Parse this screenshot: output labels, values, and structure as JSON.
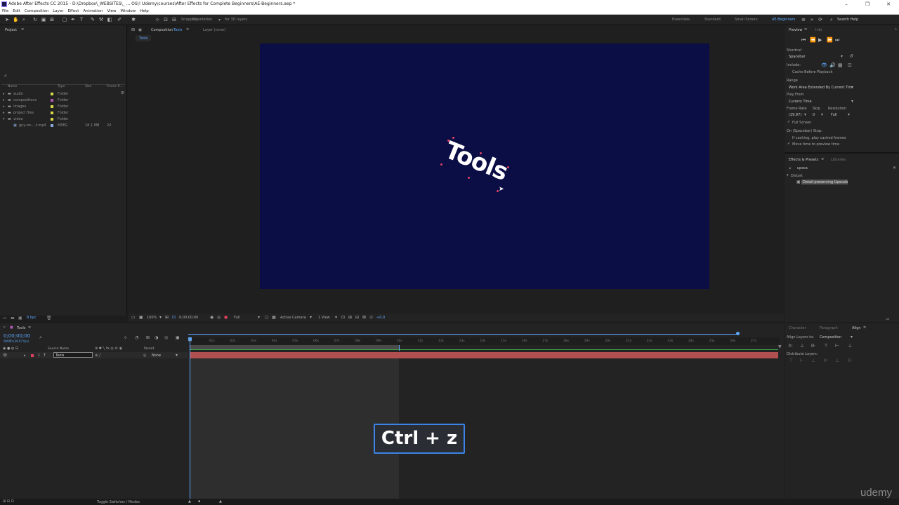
{
  "window": {
    "title": "Adobe After Effects CC 2015 - D:\\Dropbox\\_WEBSITES\\_ ... OS\\! Udemy\\courses\\After Effects for Complete Beginners\\AE-Beginners.aep *",
    "minimize": "–",
    "maximize": "❐",
    "close": "✕"
  },
  "menu": [
    "File",
    "Edit",
    "Composition",
    "Layer",
    "Effect",
    "Animation",
    "View",
    "Window",
    "Help"
  ],
  "toolbar": {
    "snapping": "Snapping",
    "orientation": "Orientation",
    "for3d": "for 3D layers",
    "workspaces": [
      "Essentials",
      "Standard",
      "Small Screen",
      "AE-Beginners"
    ],
    "search_help": "Search Help"
  },
  "project": {
    "tab": "Project",
    "columns": [
      "Name",
      "Type",
      "Size",
      "Frame R..."
    ],
    "items": [
      {
        "name": "audio",
        "type": "Folder",
        "size": "",
        "fr": "",
        "color": "#d8d84a"
      },
      {
        "name": "compositions",
        "type": "Folder",
        "size": "",
        "fr": "",
        "color": "#b05ab0"
      },
      {
        "name": "images",
        "type": "Folder",
        "size": "",
        "fr": "",
        "color": "#d8d84a"
      },
      {
        "name": "project files",
        "type": "Folder",
        "size": "",
        "fr": "",
        "color": "#d8d84a"
      },
      {
        "name": "video",
        "type": "Folder",
        "size": "",
        "fr": "",
        "color": "#d8d84a"
      },
      {
        "name": "guy-on-...t.mp4",
        "type": "MPEG",
        "size": "18.1 MB",
        "fr": "24",
        "color": "#8aa6d6"
      }
    ],
    "bpc": "8 bpc"
  },
  "composition": {
    "tab": "Composition",
    "tab_name": "Tools",
    "layer_tab": "Layer (none)",
    "subtab": "Tools",
    "canvas_text": "Tools",
    "canvas_color": "#0b0d45",
    "zoom": "100%",
    "timecode": "0;00;00;00",
    "resolution": "Full",
    "camera": "Active Camera",
    "views": "1 View",
    "exposure": "+0.0"
  },
  "preview": {
    "tab": "Preview",
    "tab2": "Info",
    "shortcut_label": "Shortcut",
    "shortcut_value": "Spacebar",
    "include_label": "Include:",
    "cache_label": "Cache Before Playback",
    "range_label": "Range",
    "range_value": "Work Area Extended By Current Tim",
    "playfrom_label": "Play From",
    "playfrom_value": "Current Time",
    "framerate_label": "Frame Rate",
    "skip_label": "Skip",
    "resolution_label": "Resolution",
    "framerate_value": "(29.97)",
    "skip_value": "0",
    "resolution_value": "Full",
    "fullscreen": "Full Screen",
    "onstop_label": "On (Spacebar) Stop:",
    "ifcaching": "If caching, play cached frames",
    "movetime": "Move time to preview time"
  },
  "effects": {
    "tab": "Effects & Presets",
    "tab2": "Libraries",
    "search": "upsca",
    "category": "Distort",
    "result": "Detail-preserving Upscale"
  },
  "timeline": {
    "tab": "Tools",
    "timecode": "0;00;00;00",
    "fps": "00000 (29.97 fps)",
    "columns": [
      "Source Name",
      "Parent"
    ],
    "layer_num": "1",
    "layer_name": "Tools",
    "parent": "None",
    "ticks": [
      "0s",
      "01s",
      "02s",
      "03s",
      "04s",
      "05s",
      "06s",
      "07s",
      "08s",
      "09s",
      "10s",
      "11s",
      "12s",
      "13s",
      "14s",
      "15s",
      "16s",
      "17s",
      "18s",
      "19s",
      "20s",
      "21s",
      "22s",
      "23s",
      "24s",
      "25s",
      "26s",
      "27s"
    ],
    "toggle": "Toggle Switches / Modes"
  },
  "align": {
    "tabs": [
      "Character",
      "Paragraph",
      "Align"
    ],
    "align_to_label": "Align Layers to:",
    "align_to_value": "Composition",
    "distribute": "Distribute Layers:"
  },
  "shortcut_overlay": "Ctrl + z",
  "watermark": "udemy"
}
